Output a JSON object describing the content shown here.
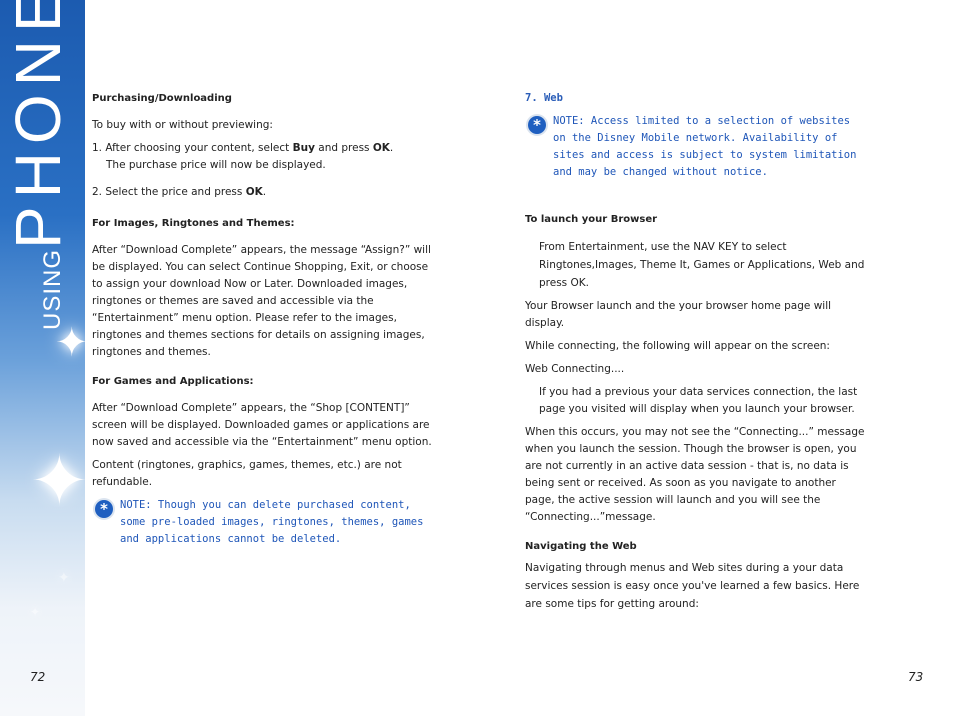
{
  "sidebar": {
    "using": "USING",
    "title": "PHONE MENUS"
  },
  "left": {
    "h1": "Purchasing/Downloading",
    "p1": "To buy with or without previewing:",
    "step1_pre": "1. After choosing your content, select ",
    "step1_buy": "Buy",
    "step1_mid": " and press ",
    "step1_ok": "OK",
    "step1_post": ".",
    "step1_line2": "The purchase price will now be displayed.",
    "step2_pre": "2. Select the price and press ",
    "step2_ok": "OK",
    "step2_post": ".",
    "h2": "For Images, Ringtones and Themes:",
    "p2": "After “Download Complete” appears, the message “Assign?” will be displayed. You can select Continue Shopping, Exit, or choose to assign your download Now or Later. Downloaded images, ringtones or themes are saved and accessible via the “Entertainment” menu option. Please refer to the images, ringtones and themes sections for details on assigning images, ringtones and themes.",
    "h3": "For Games and Applications:",
    "p3": "After “Download Complete” appears, the “Shop [CONTENT]” screen will be displayed. Downloaded games or applications are now saved and accessible via the “Entertainment” menu option.",
    "p4": "Content (ringtones, graphics, games, themes, etc.) are not refundable.",
    "note": "NOTE: Though you can delete purchased content, some pre-loaded images, ringtones, themes, games and applications cannot be deleted.",
    "page_number": "72"
  },
  "right": {
    "h1": "7. Web",
    "note": "NOTE: Access limited to a selection of websites on the Disney Mobile network. Availability of sites and access is subject to system limitation and may be changed without notice.",
    "h2": "To launch your Browser",
    "p1": "From Entertainment, use the NAV KEY to select Ringtones,Images, Theme It, Games or Applications, Web and press OK.",
    "p2": "Your Browser launch and the your browser home page will display.",
    "p3": "While connecting, the following will appear on the screen:",
    "p4": "Web Connecting....",
    "p5": "If you had a previous your data services connection, the last page you visited will display when you launch your browser.",
    "p6": "When this occurs, you may not see the “Connecting...” message when you launch the session. Though the browser is open, you are not currently in an active data session - that is, no data is being sent or received. As soon as you navigate to another page, the active session will launch and you will see the “Connecting...”message.",
    "h3": "Navigating the Web",
    "p7": "Navigating through menus and Web sites during a your data services session is easy once you've learned a few basics. Here are some tips for getting around:",
    "page_number": "73"
  }
}
